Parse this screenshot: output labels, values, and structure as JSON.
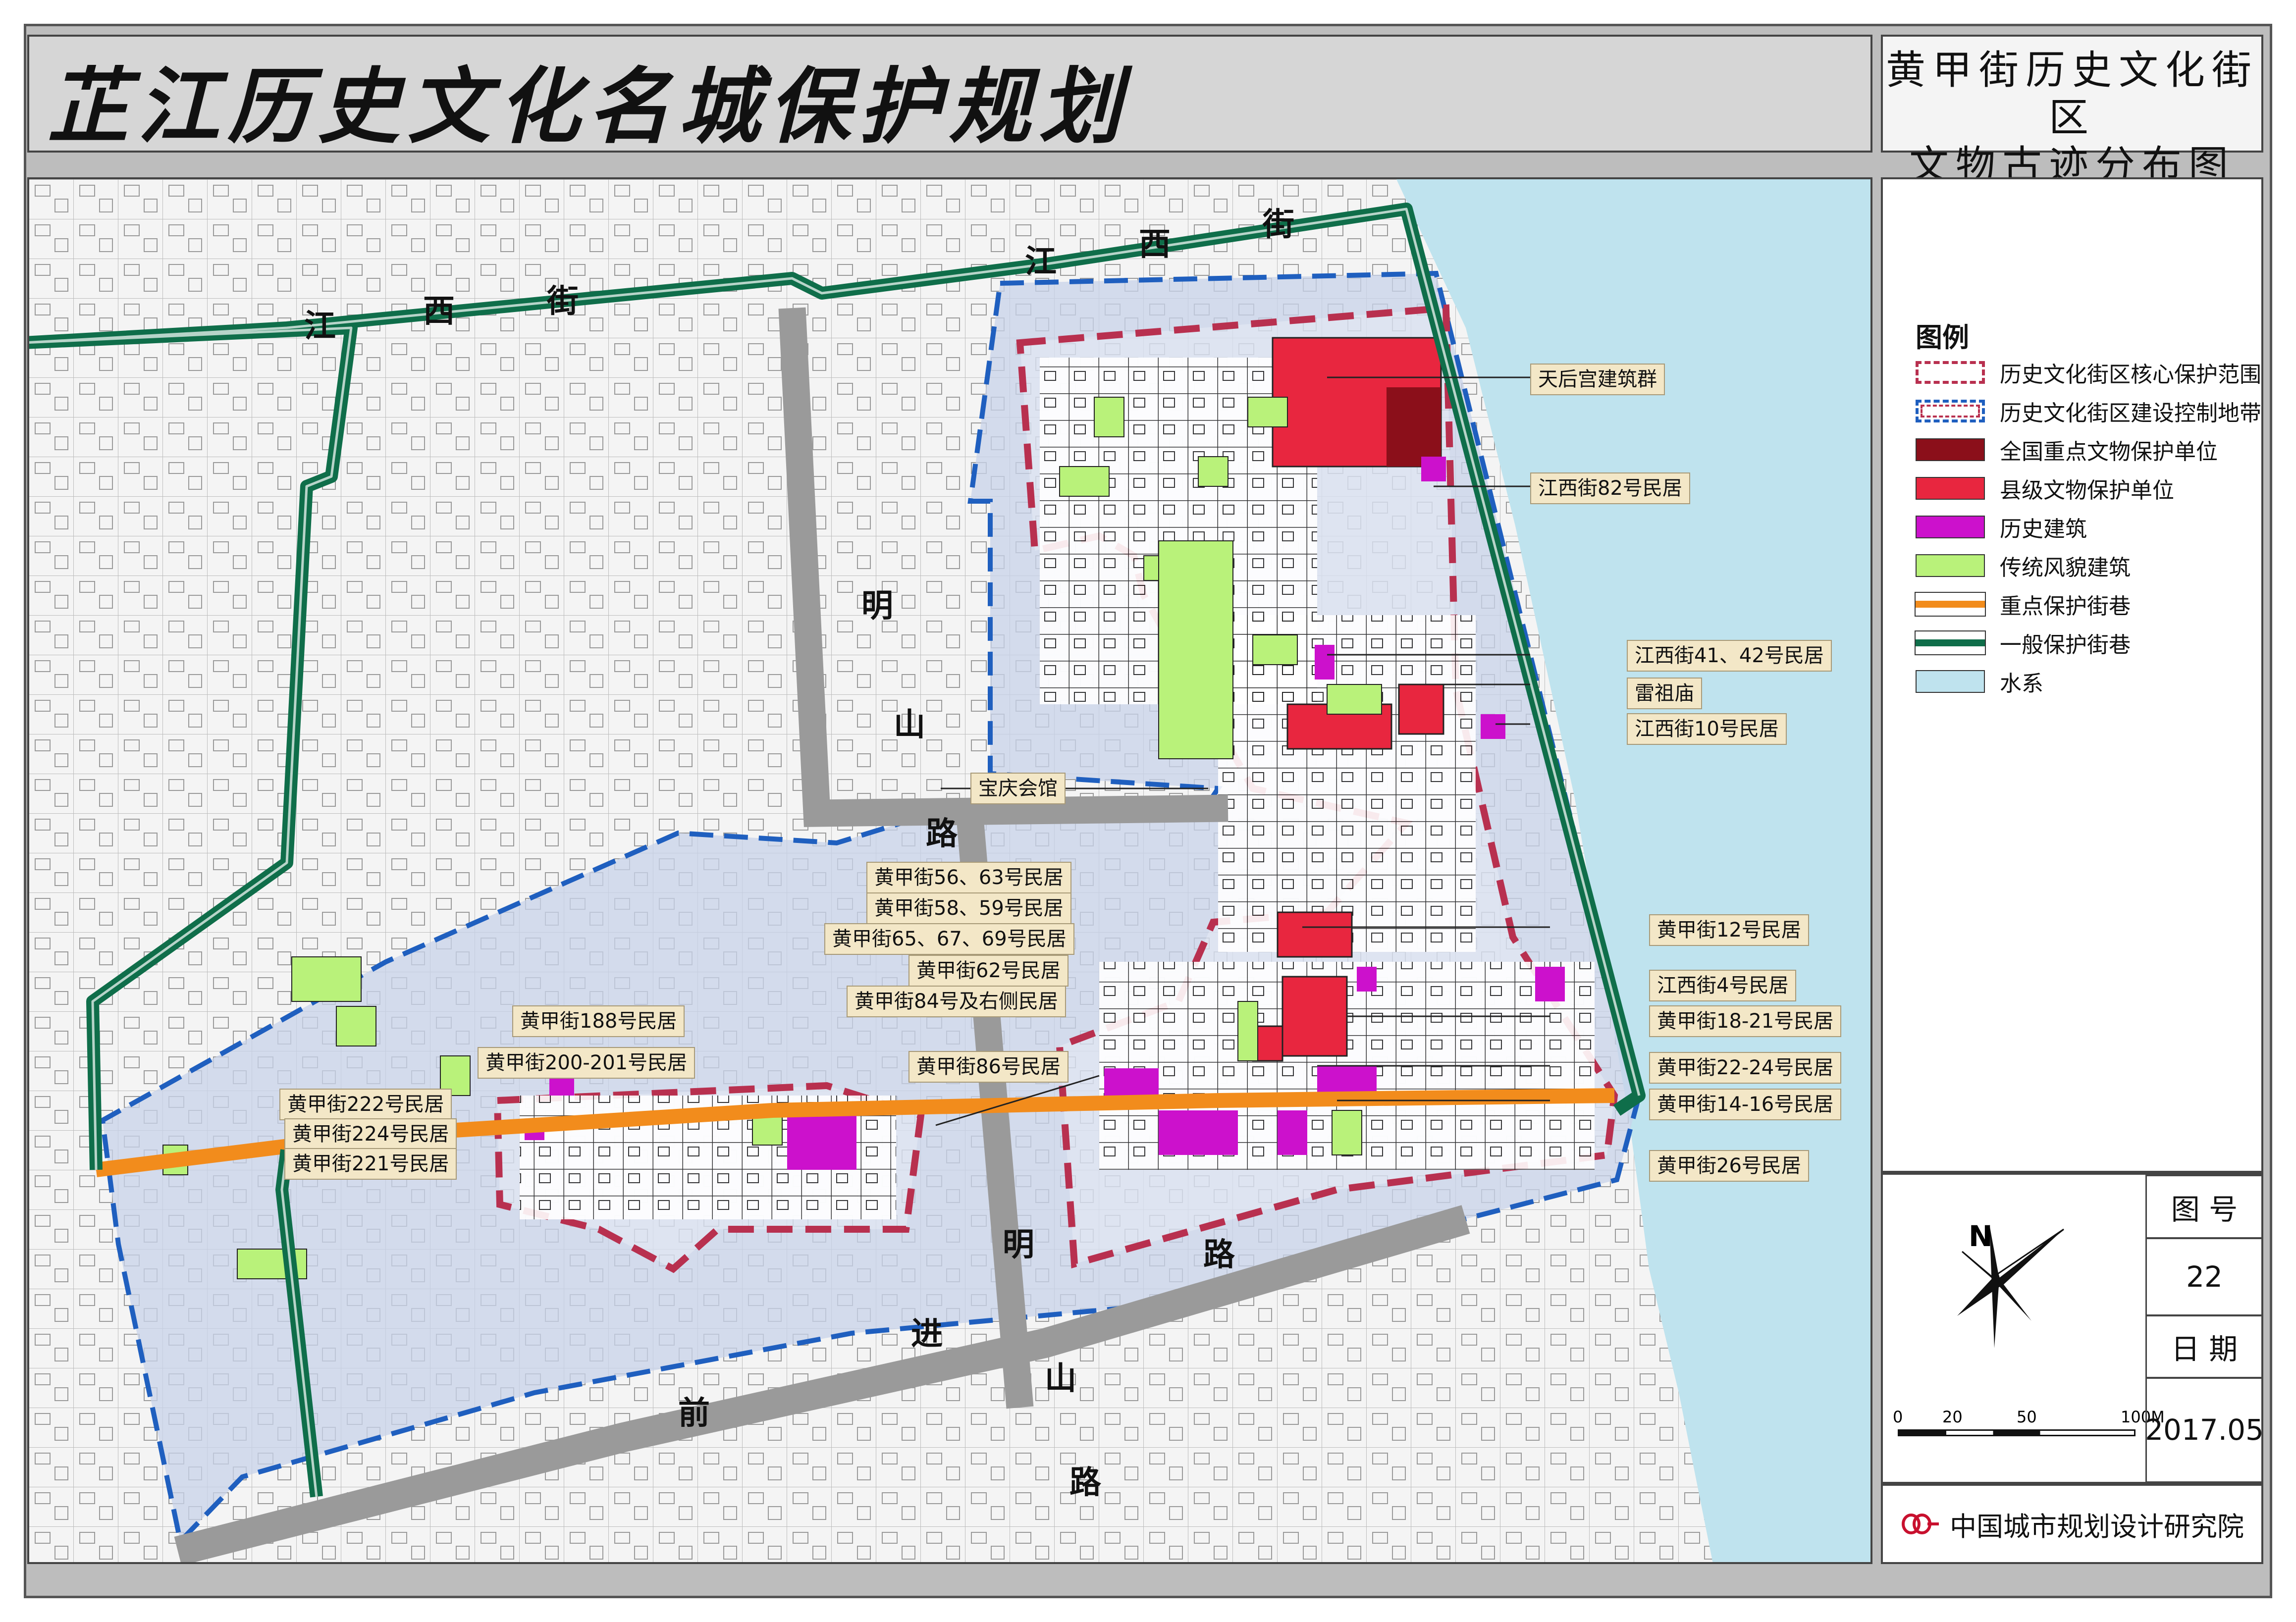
{
  "header": {
    "main_title": "芷江历史文化名城保护规划",
    "sub_title_line1": "黄甲街历史文化街区",
    "sub_title_line2": "文物古迹分布图"
  },
  "legend": {
    "title": "图例",
    "items": [
      {
        "label": "历史文化街区核心保护范围",
        "symbol": "dashed-red-box",
        "color": "#b8304f"
      },
      {
        "label": "历史文化街区建设控制地带",
        "symbol": "dashed-blue-box",
        "color": "#1f5fbf"
      },
      {
        "label": "全国重点文物保护单位",
        "symbol": "fill",
        "color": "#8b0f1a"
      },
      {
        "label": "县级文物保护单位",
        "symbol": "fill",
        "color": "#e8263f"
      },
      {
        "label": "历史建筑",
        "symbol": "fill",
        "color": "#cc11cc"
      },
      {
        "label": "传统风貌建筑",
        "symbol": "fill",
        "color": "#b9f27a"
      },
      {
        "label": "重点保护街巷",
        "symbol": "line",
        "color": "#f28c1c"
      },
      {
        "label": "一般保护街巷",
        "symbol": "line",
        "color": "#0f6e4a"
      },
      {
        "label": "水系",
        "symbol": "fill",
        "color": "#bfe3ee"
      }
    ]
  },
  "info": {
    "figure_no_label": "图 号",
    "figure_no": "22",
    "date_label": "日 期",
    "date": "2017.05",
    "north_label": "N",
    "scale_ticks": [
      "0",
      "20",
      "50",
      "100M"
    ]
  },
  "org": {
    "name": "中国城市规划设计研究院",
    "logo_icon": "cau-logo-icon"
  },
  "streets": {
    "jiangxi_jie": [
      "江",
      "西",
      "街"
    ],
    "jiangxi_jie_east": [
      "江",
      "西",
      "街"
    ],
    "mingshan_lu_north": [
      "明",
      "山",
      "路"
    ],
    "mingshan_lu_south": [
      "明",
      "路"
    ],
    "qianjin_shan_lu": [
      "前",
      "进",
      "山",
      "路"
    ]
  },
  "sites": [
    {
      "label": "天后宫建筑群"
    },
    {
      "label": "江西街82号民居"
    },
    {
      "label": "江西街41、42号民居"
    },
    {
      "label": "雷祖庙"
    },
    {
      "label": "江西街10号民居"
    },
    {
      "label": "宝庆会馆"
    },
    {
      "label": "黄甲街56、63号民居"
    },
    {
      "label": "黄甲街58、59号民居"
    },
    {
      "label": "黄甲街65、67、69号民居"
    },
    {
      "label": "黄甲街62号民居"
    },
    {
      "label": "黄甲街84号及右侧民居"
    },
    {
      "label": "黄甲街86号民居"
    },
    {
      "label": "黄甲街188号民居"
    },
    {
      "label": "黄甲街200-201号民居"
    },
    {
      "label": "黄甲街222号民居"
    },
    {
      "label": "黄甲街224号民居"
    },
    {
      "label": "黄甲街221号民居"
    },
    {
      "label": "黄甲街12号民居"
    },
    {
      "label": "江西街4号民居"
    },
    {
      "label": "黄甲街18-21号民居"
    },
    {
      "label": "黄甲街22-24号民居"
    },
    {
      "label": "黄甲街14-16号民居"
    },
    {
      "label": "黄甲街26号民居"
    }
  ]
}
